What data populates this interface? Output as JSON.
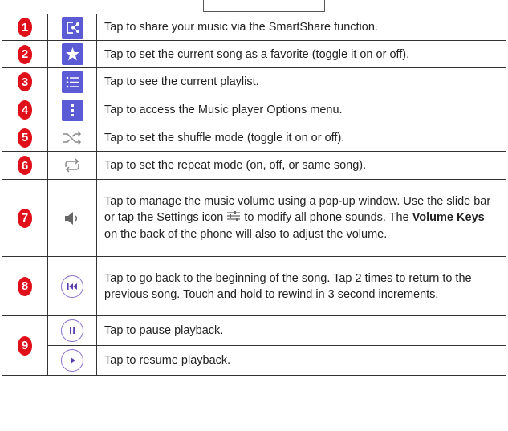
{
  "rows": [
    {
      "num": "1",
      "icon": "smartshare-icon",
      "desc": "Tap to share your music via the SmartShare function."
    },
    {
      "num": "2",
      "icon": "favorite-star-icon",
      "desc": "Tap to set the current song as a favorite (toggle it on or off)."
    },
    {
      "num": "3",
      "icon": "playlist-icon",
      "desc": "Tap to see the current playlist."
    },
    {
      "num": "4",
      "icon": "options-menu-icon",
      "desc": "Tap to access the Music player Options menu."
    },
    {
      "num": "5",
      "icon": "shuffle-icon",
      "desc": "Tap to set the shuffle mode (toggle it on or off)."
    },
    {
      "num": "6",
      "icon": "repeat-icon",
      "desc": "Tap to set the repeat mode (on, off, or same song)."
    },
    {
      "num": "7",
      "icon": "volume-icon",
      "desc_a": "Tap to manage the music volume using a pop-up window. Use the slide bar or tap the Settings icon",
      "desc_b": "to modify all phone sounds. The",
      "desc_bold": "Volume Keys",
      "desc_c": "on the back of the phone will also to adjust the volume."
    },
    {
      "num": "8",
      "icon": "rewind-icon",
      "desc": "Tap to go back to the beginning of the song. Tap 2 times to return to the previous song. Touch and hold to rewind in 3 second increments."
    },
    {
      "num": "9",
      "icon": "pause-icon",
      "desc": "Tap to pause playback."
    },
    {
      "num": "",
      "icon": "play-icon",
      "desc": "Tap to resume playback."
    }
  ],
  "colors": {
    "badge": "#e0101a",
    "tile": "#5b5bd6",
    "circle_icon": "#8b6fcf"
  }
}
